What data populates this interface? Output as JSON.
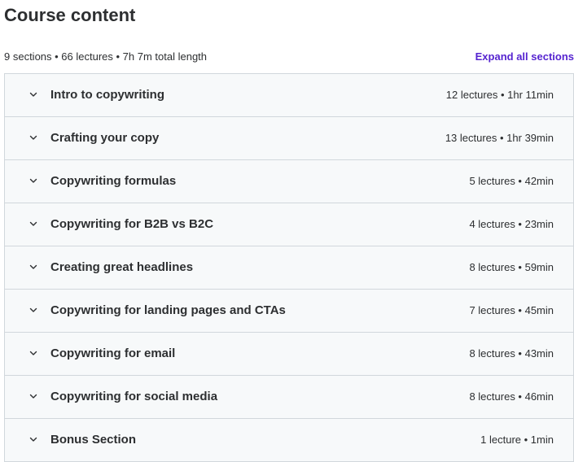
{
  "header": {
    "title": "Course content",
    "summary": "9 sections • 66 lectures • 7h 7m total length",
    "expand_label": "Expand all sections"
  },
  "colors": {
    "link": "#5624d0",
    "section_bg": "#f7f9fa",
    "border": "#d1d7dc",
    "text": "#2d2f31"
  },
  "icons": {
    "section_toggle": "chevron-down-icon"
  },
  "sections": [
    {
      "title": "Intro to copywriting",
      "meta": "12 lectures • 1hr 11min"
    },
    {
      "title": "Crafting your copy",
      "meta": "13 lectures • 1hr 39min"
    },
    {
      "title": "Copywriting formulas",
      "meta": "5 lectures • 42min"
    },
    {
      "title": "Copywriting for B2B vs B2C",
      "meta": "4 lectures • 23min"
    },
    {
      "title": "Creating great headlines",
      "meta": "8 lectures • 59min"
    },
    {
      "title": "Copywriting for landing pages and CTAs",
      "meta": "7 lectures • 45min"
    },
    {
      "title": "Copywriting for email",
      "meta": "8 lectures • 43min"
    },
    {
      "title": "Copywriting for social media",
      "meta": "8 lectures • 46min"
    },
    {
      "title": "Bonus Section",
      "meta": "1 lecture • 1min"
    }
  ]
}
